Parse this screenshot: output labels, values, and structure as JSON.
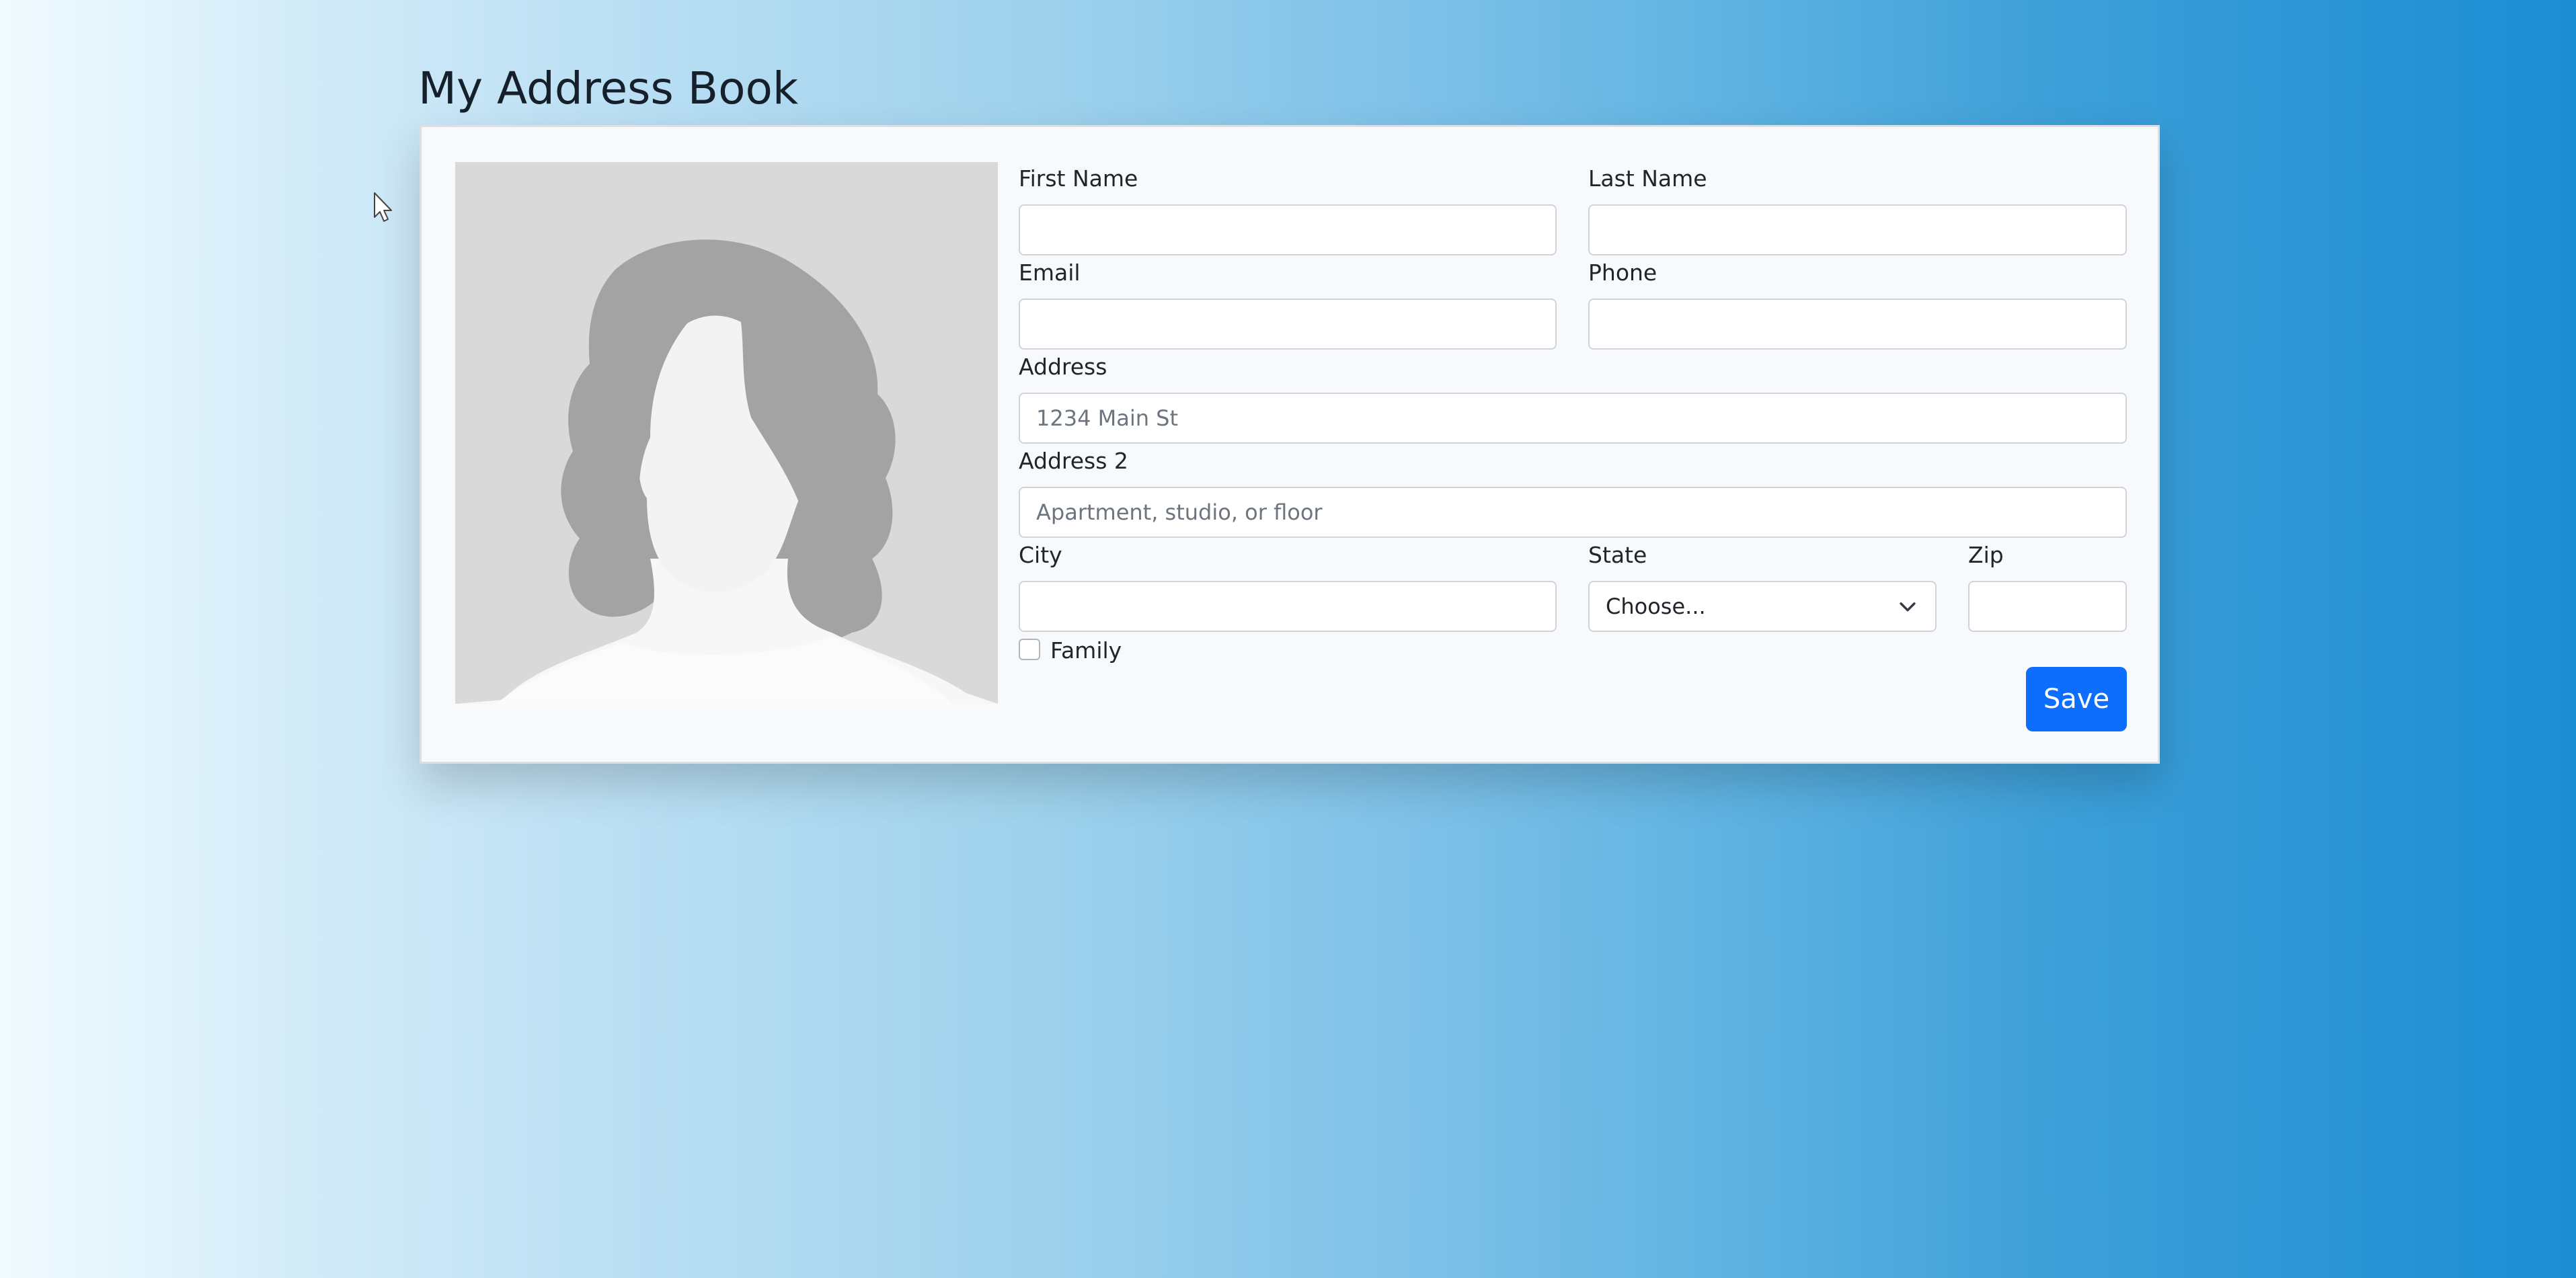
{
  "page": {
    "title": "My Address Book"
  },
  "form": {
    "avatar_icon": "female-avatar-placeholder",
    "first_name": {
      "label": "First Name",
      "value": "",
      "placeholder": ""
    },
    "last_name": {
      "label": "Last Name",
      "value": "",
      "placeholder": ""
    },
    "email": {
      "label": "Email",
      "value": "",
      "placeholder": ""
    },
    "phone": {
      "label": "Phone",
      "value": "",
      "placeholder": ""
    },
    "address": {
      "label": "Address",
      "value": "",
      "placeholder": "1234 Main St"
    },
    "address2": {
      "label": "Address 2",
      "value": "",
      "placeholder": "Apartment, studio, or floor"
    },
    "city": {
      "label": "City",
      "value": "",
      "placeholder": ""
    },
    "state": {
      "label": "State",
      "selected": "Choose..."
    },
    "zip": {
      "label": "Zip",
      "value": "",
      "placeholder": ""
    },
    "family": {
      "label": "Family",
      "checked": false
    },
    "save_label": "Save"
  },
  "colors": {
    "accent": "#0d6efd",
    "card_background": "#f8f9fa",
    "gradient_start": "#f0fbff",
    "gradient_end": "#1b8dd3"
  }
}
